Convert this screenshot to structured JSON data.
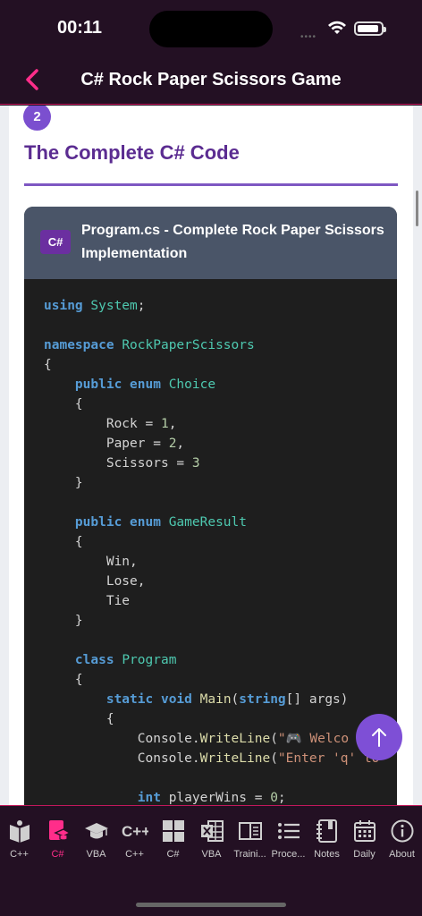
{
  "status": {
    "time": "00:11"
  },
  "nav": {
    "title": "C# Rock Paper Scissors Game"
  },
  "section": {
    "step": "2",
    "title": "The Complete C# Code"
  },
  "code_block": {
    "lang_badge": "C#",
    "title": "Program.cs - Complete Rock Paper Scissors Implementation"
  },
  "tabs": [
    {
      "label": "C++",
      "icon": "book-icon"
    },
    {
      "label": "C#",
      "icon": "graduation-book-icon"
    },
    {
      "label": "VBA",
      "icon": "graduation-cap-icon"
    },
    {
      "label": "C++",
      "icon": "cplusplus-icon"
    },
    {
      "label": "C#",
      "icon": "windows-icon"
    },
    {
      "label": "VBA",
      "icon": "excel-icon"
    },
    {
      "label": "Traini...",
      "icon": "training-icon"
    },
    {
      "label": "Proce...",
      "icon": "list-icon"
    },
    {
      "label": "Notes",
      "icon": "notebook-icon"
    },
    {
      "label": "Daily",
      "icon": "calendar-icon"
    },
    {
      "label": "About",
      "icon": "info-icon"
    }
  ],
  "colors": {
    "accent": "#ff2d8a",
    "purple": "#5b2c91",
    "header_bg": "#231023"
  }
}
